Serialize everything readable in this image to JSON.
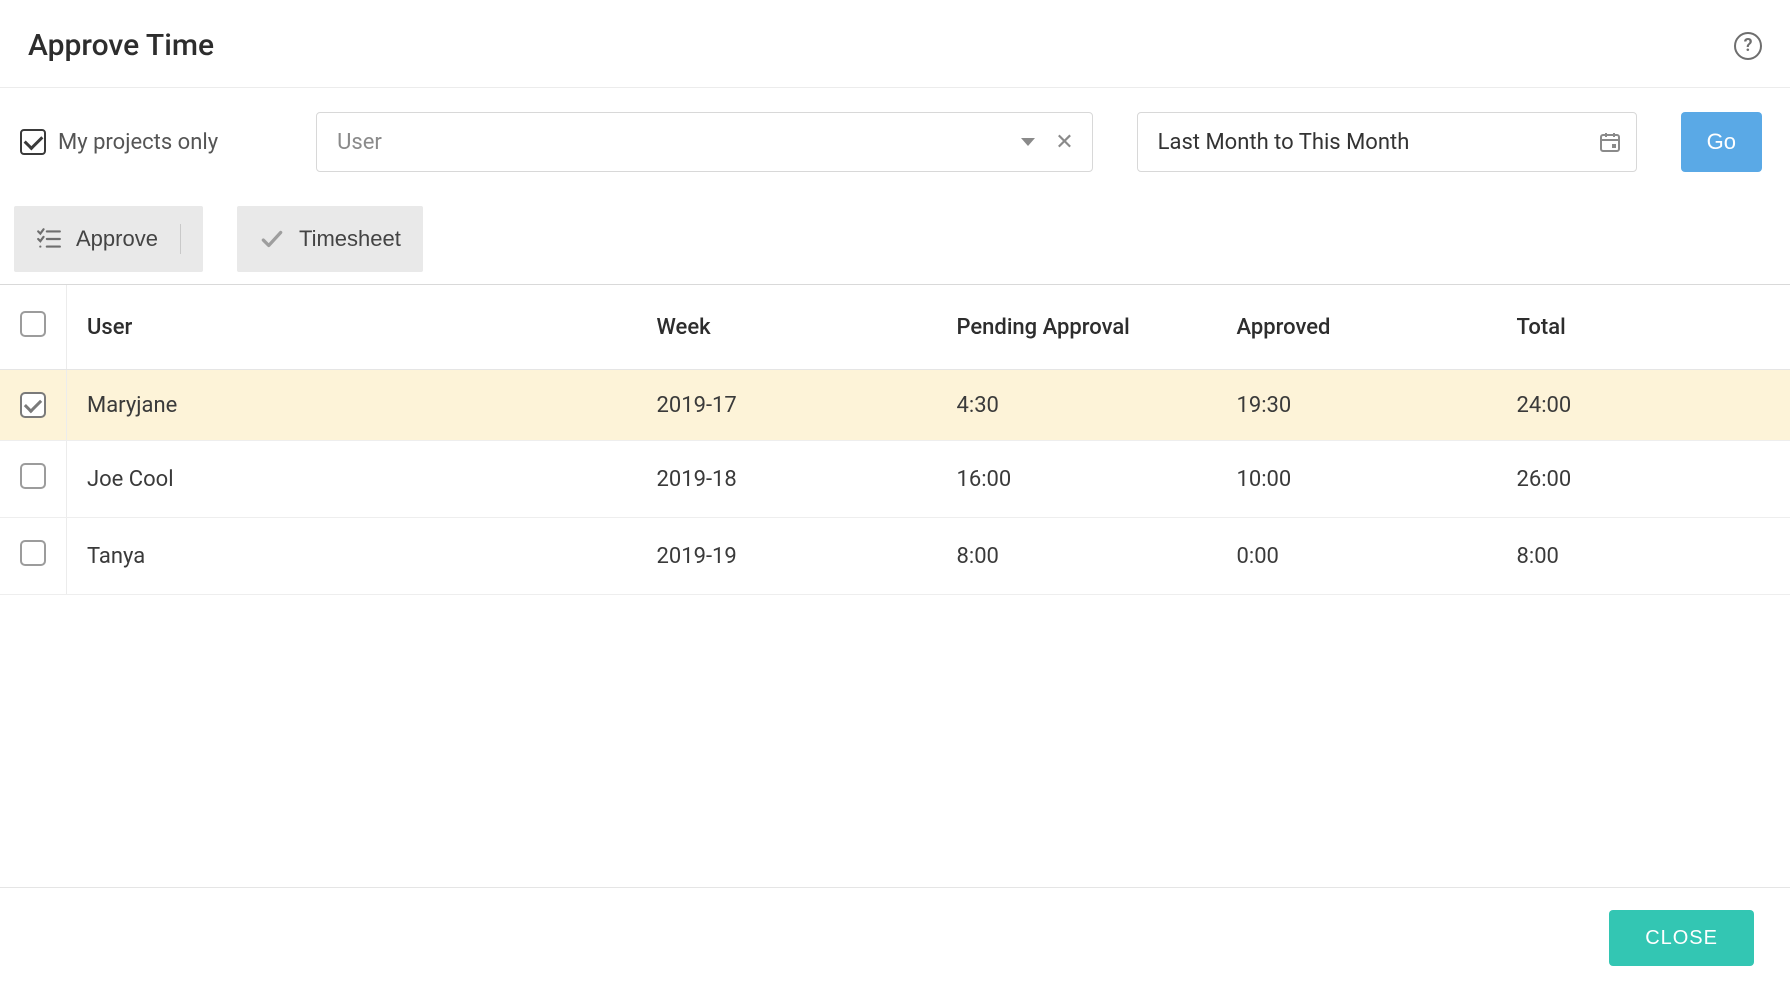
{
  "header": {
    "title": "Approve Time"
  },
  "filters": {
    "my_projects_label": "My projects only",
    "my_projects_checked": true,
    "user_placeholder": "User",
    "date_range": "Last Month to This Month",
    "go_label": "Go"
  },
  "actions": {
    "approve_label": "Approve",
    "timesheet_label": "Timesheet"
  },
  "table": {
    "columns": {
      "user": "User",
      "week": "Week",
      "pending": "Pending Approval",
      "approved": "Approved",
      "total": "Total"
    },
    "rows": [
      {
        "selected": true,
        "user": "Maryjane",
        "week": "2019-17",
        "pending": "4:30",
        "approved": "19:30",
        "total": "24:00"
      },
      {
        "selected": false,
        "user": "Joe Cool",
        "week": "2019-18",
        "pending": "16:00",
        "approved": "10:00",
        "total": "26:00"
      },
      {
        "selected": false,
        "user": "Tanya",
        "week": "2019-19",
        "pending": "8:00",
        "approved": "0:00",
        "total": "8:00"
      }
    ]
  },
  "footer": {
    "close_label": "CLOSE"
  }
}
